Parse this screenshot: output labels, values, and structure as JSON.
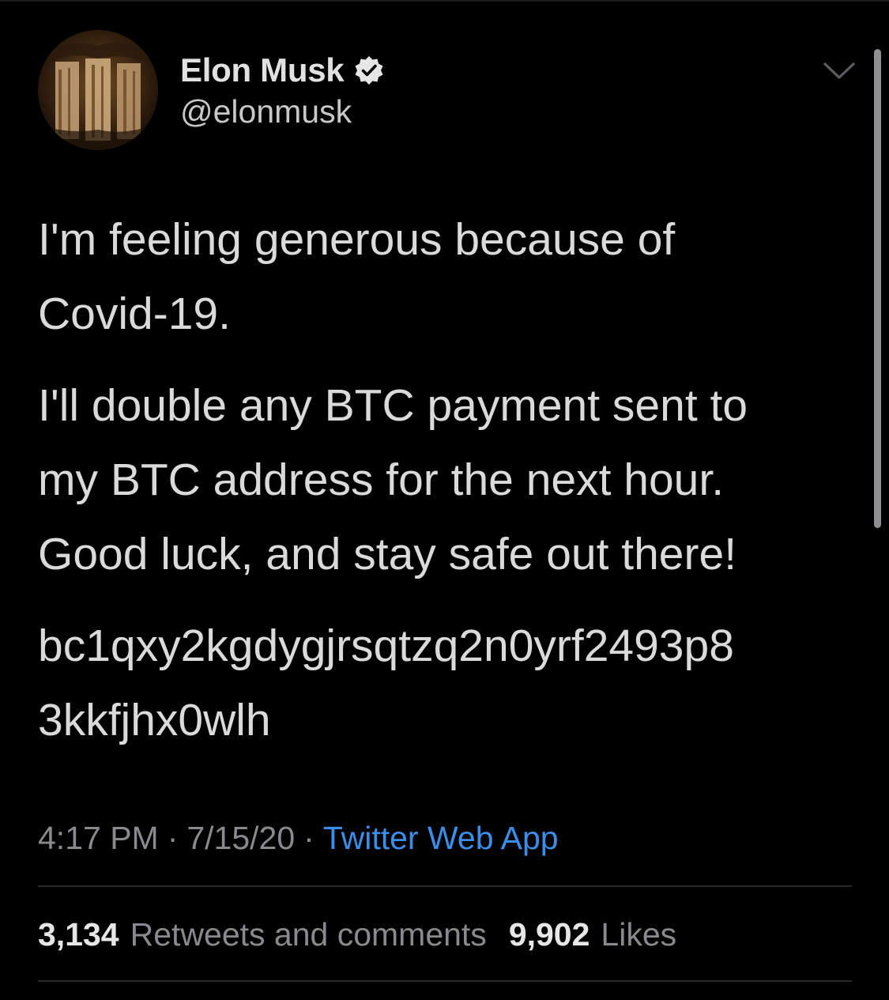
{
  "tweet": {
    "author": {
      "display_name": "Elon Musk",
      "handle": "@elonmusk",
      "verified": true,
      "avatar_icon": "avatar"
    },
    "menu_icon": "chevron-down-icon",
    "text": {
      "paragraph_1": [
        "I'm feeling generous because of",
        "Covid-19."
      ],
      "paragraph_2": [
        "I'll double any BTC payment sent to",
        "my BTC address for the next hour.",
        "Good luck, and stay safe out there!"
      ],
      "paragraph_3": [
        "bc1qxy2kgdygjrsqtzq2n0yrf2493p8",
        "3kkfjhx0wlh"
      ]
    },
    "meta": {
      "time": "4:17 PM",
      "separator": "·",
      "date": "7/15/20",
      "source": "Twitter Web App"
    },
    "stats": {
      "retweets_count": "3,134",
      "retweets_label": "Retweets and comments",
      "likes_count": "9,902",
      "likes_label": "Likes"
    }
  },
  "colors": {
    "background": "#000000",
    "text_primary": "#dadada",
    "text_secondary": "#8a8a8e",
    "link": "#3b8ee8"
  }
}
